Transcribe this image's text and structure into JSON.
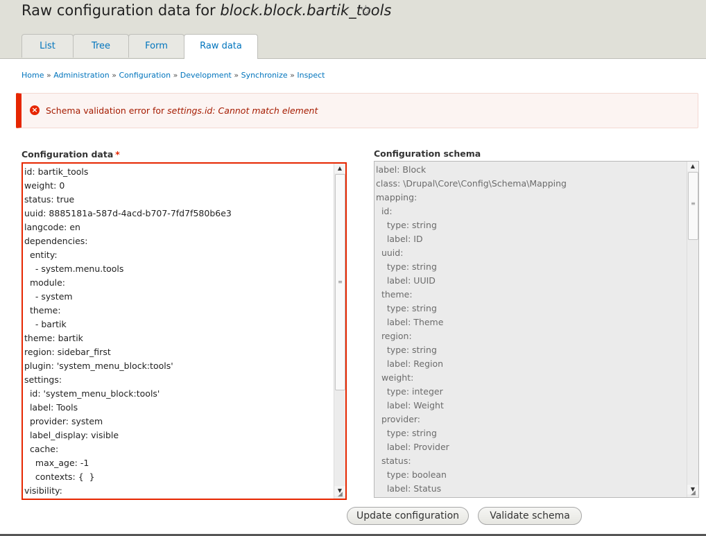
{
  "header": {
    "title_prefix": "Raw configuration data for ",
    "title_name": "block.block.bartik_tools",
    "star": "☆"
  },
  "tabs": [
    {
      "label": "List"
    },
    {
      "label": "Tree"
    },
    {
      "label": "Form"
    },
    {
      "label": "Raw data"
    }
  ],
  "active_tab": "Raw data",
  "breadcrumb": [
    "Home",
    "Administration",
    "Configuration",
    "Development",
    "Synchronize",
    "Inspect"
  ],
  "breadcrumb_separator": "»",
  "error": {
    "icon": "×",
    "prefix": "Schema validation error for ",
    "key": "settings.id",
    "suffix": ": Cannot match element"
  },
  "config": {
    "label": "Configuration data",
    "required_mark": "*",
    "lines": [
      "id: bartik_tools",
      "weight: 0",
      "status: true",
      "uuid: 8885181a-587d-4acd-b707-7fd7f580b6e3",
      "langcode: en",
      "dependencies:",
      "  entity:",
      "    - system.menu.tools",
      "  module:",
      "    - system",
      "  theme:",
      "    - bartik",
      "theme: bartik",
      "region: sidebar_first",
      "plugin: 'system_menu_block:tools'",
      "settings:",
      "  id: 'system_menu_block:tools'",
      "  label: Tools",
      "  provider: system",
      "  label_display: visible",
      "  cache:",
      "    max_age: -1",
      "    contexts: {  }",
      "visibility:"
    ]
  },
  "schema": {
    "label": "Configuration schema",
    "lines": [
      "label: Block",
      "class: \\Drupal\\Core\\Config\\Schema\\Mapping",
      "mapping:",
      "  id:",
      "    type: string",
      "    label: ID",
      "  uuid:",
      "    type: string",
      "    label: UUID",
      "  theme:",
      "    type: string",
      "    label: Theme",
      "  region:",
      "    type: string",
      "    label: Region",
      "  weight:",
      "    type: integer",
      "    label: Weight",
      "  provider:",
      "    type: string",
      "    label: Provider",
      "  status:",
      "    type: boolean",
      "    label: Status"
    ]
  },
  "buttons": {
    "update": "Update configuration",
    "validate": "Validate schema"
  },
  "colors": {
    "error_accent": "#e62600",
    "link": "#0074bd",
    "header_bg": "#e0e0d8"
  }
}
